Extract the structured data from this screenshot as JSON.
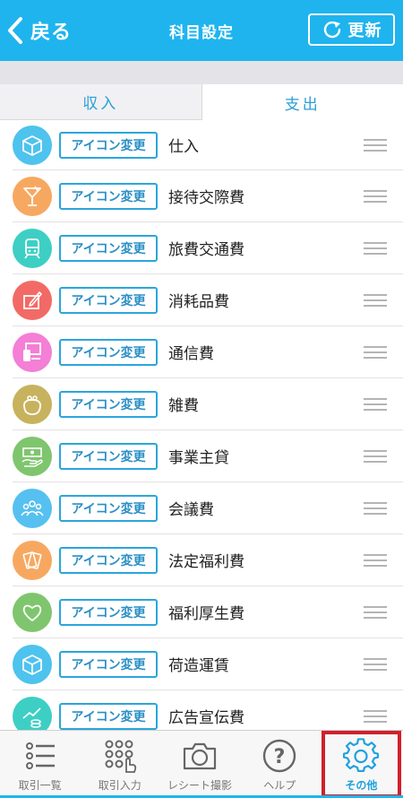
{
  "header": {
    "back_label": "戻る",
    "title": "科目設定",
    "refresh_label": "更新",
    "color": "#1fb4ee"
  },
  "tabs": [
    {
      "label": "収入",
      "active": false
    },
    {
      "label": "支出",
      "active": true
    }
  ],
  "change_icon_label": "アイコン変更",
  "categories": [
    {
      "name": "仕入",
      "icon": "box-icon",
      "color": "#4ec3ee"
    },
    {
      "name": "接待交際費",
      "icon": "cocktail-icon",
      "color": "#f7a860"
    },
    {
      "name": "旅費交通費",
      "icon": "train-icon",
      "color": "#3ecfc4"
    },
    {
      "name": "消耗品費",
      "icon": "pen-note-icon",
      "color": "#f26a66"
    },
    {
      "name": "通信費",
      "icon": "phone-computer-icon",
      "color": "#f37fd6"
    },
    {
      "name": "雑費",
      "icon": "purse-icon",
      "color": "#c7b25e"
    },
    {
      "name": "事業主貸",
      "icon": "money-hand-icon",
      "color": "#7fc56e"
    },
    {
      "name": "会議費",
      "icon": "people-icon",
      "color": "#56c0f0"
    },
    {
      "name": "法定福利費",
      "icon": "cards-icon",
      "color": "#f7a860"
    },
    {
      "name": "福利厚生費",
      "icon": "heart-icon",
      "color": "#7fc56e"
    },
    {
      "name": "荷造運賃",
      "icon": "box-icon",
      "color": "#4ec3ee"
    },
    {
      "name": "広告宣伝費",
      "icon": "growth-icon",
      "color": "#3ecfc4"
    }
  ],
  "nav": [
    {
      "label": "取引一覧",
      "icon": "list-icon",
      "active": false
    },
    {
      "label": "取引入力",
      "icon": "keypad-icon",
      "active": false
    },
    {
      "label": "レシート撮影",
      "icon": "camera-icon",
      "active": false
    },
    {
      "label": "ヘルプ",
      "icon": "help-icon",
      "active": false
    },
    {
      "label": "その他",
      "icon": "gear-icon",
      "active": true
    }
  ]
}
